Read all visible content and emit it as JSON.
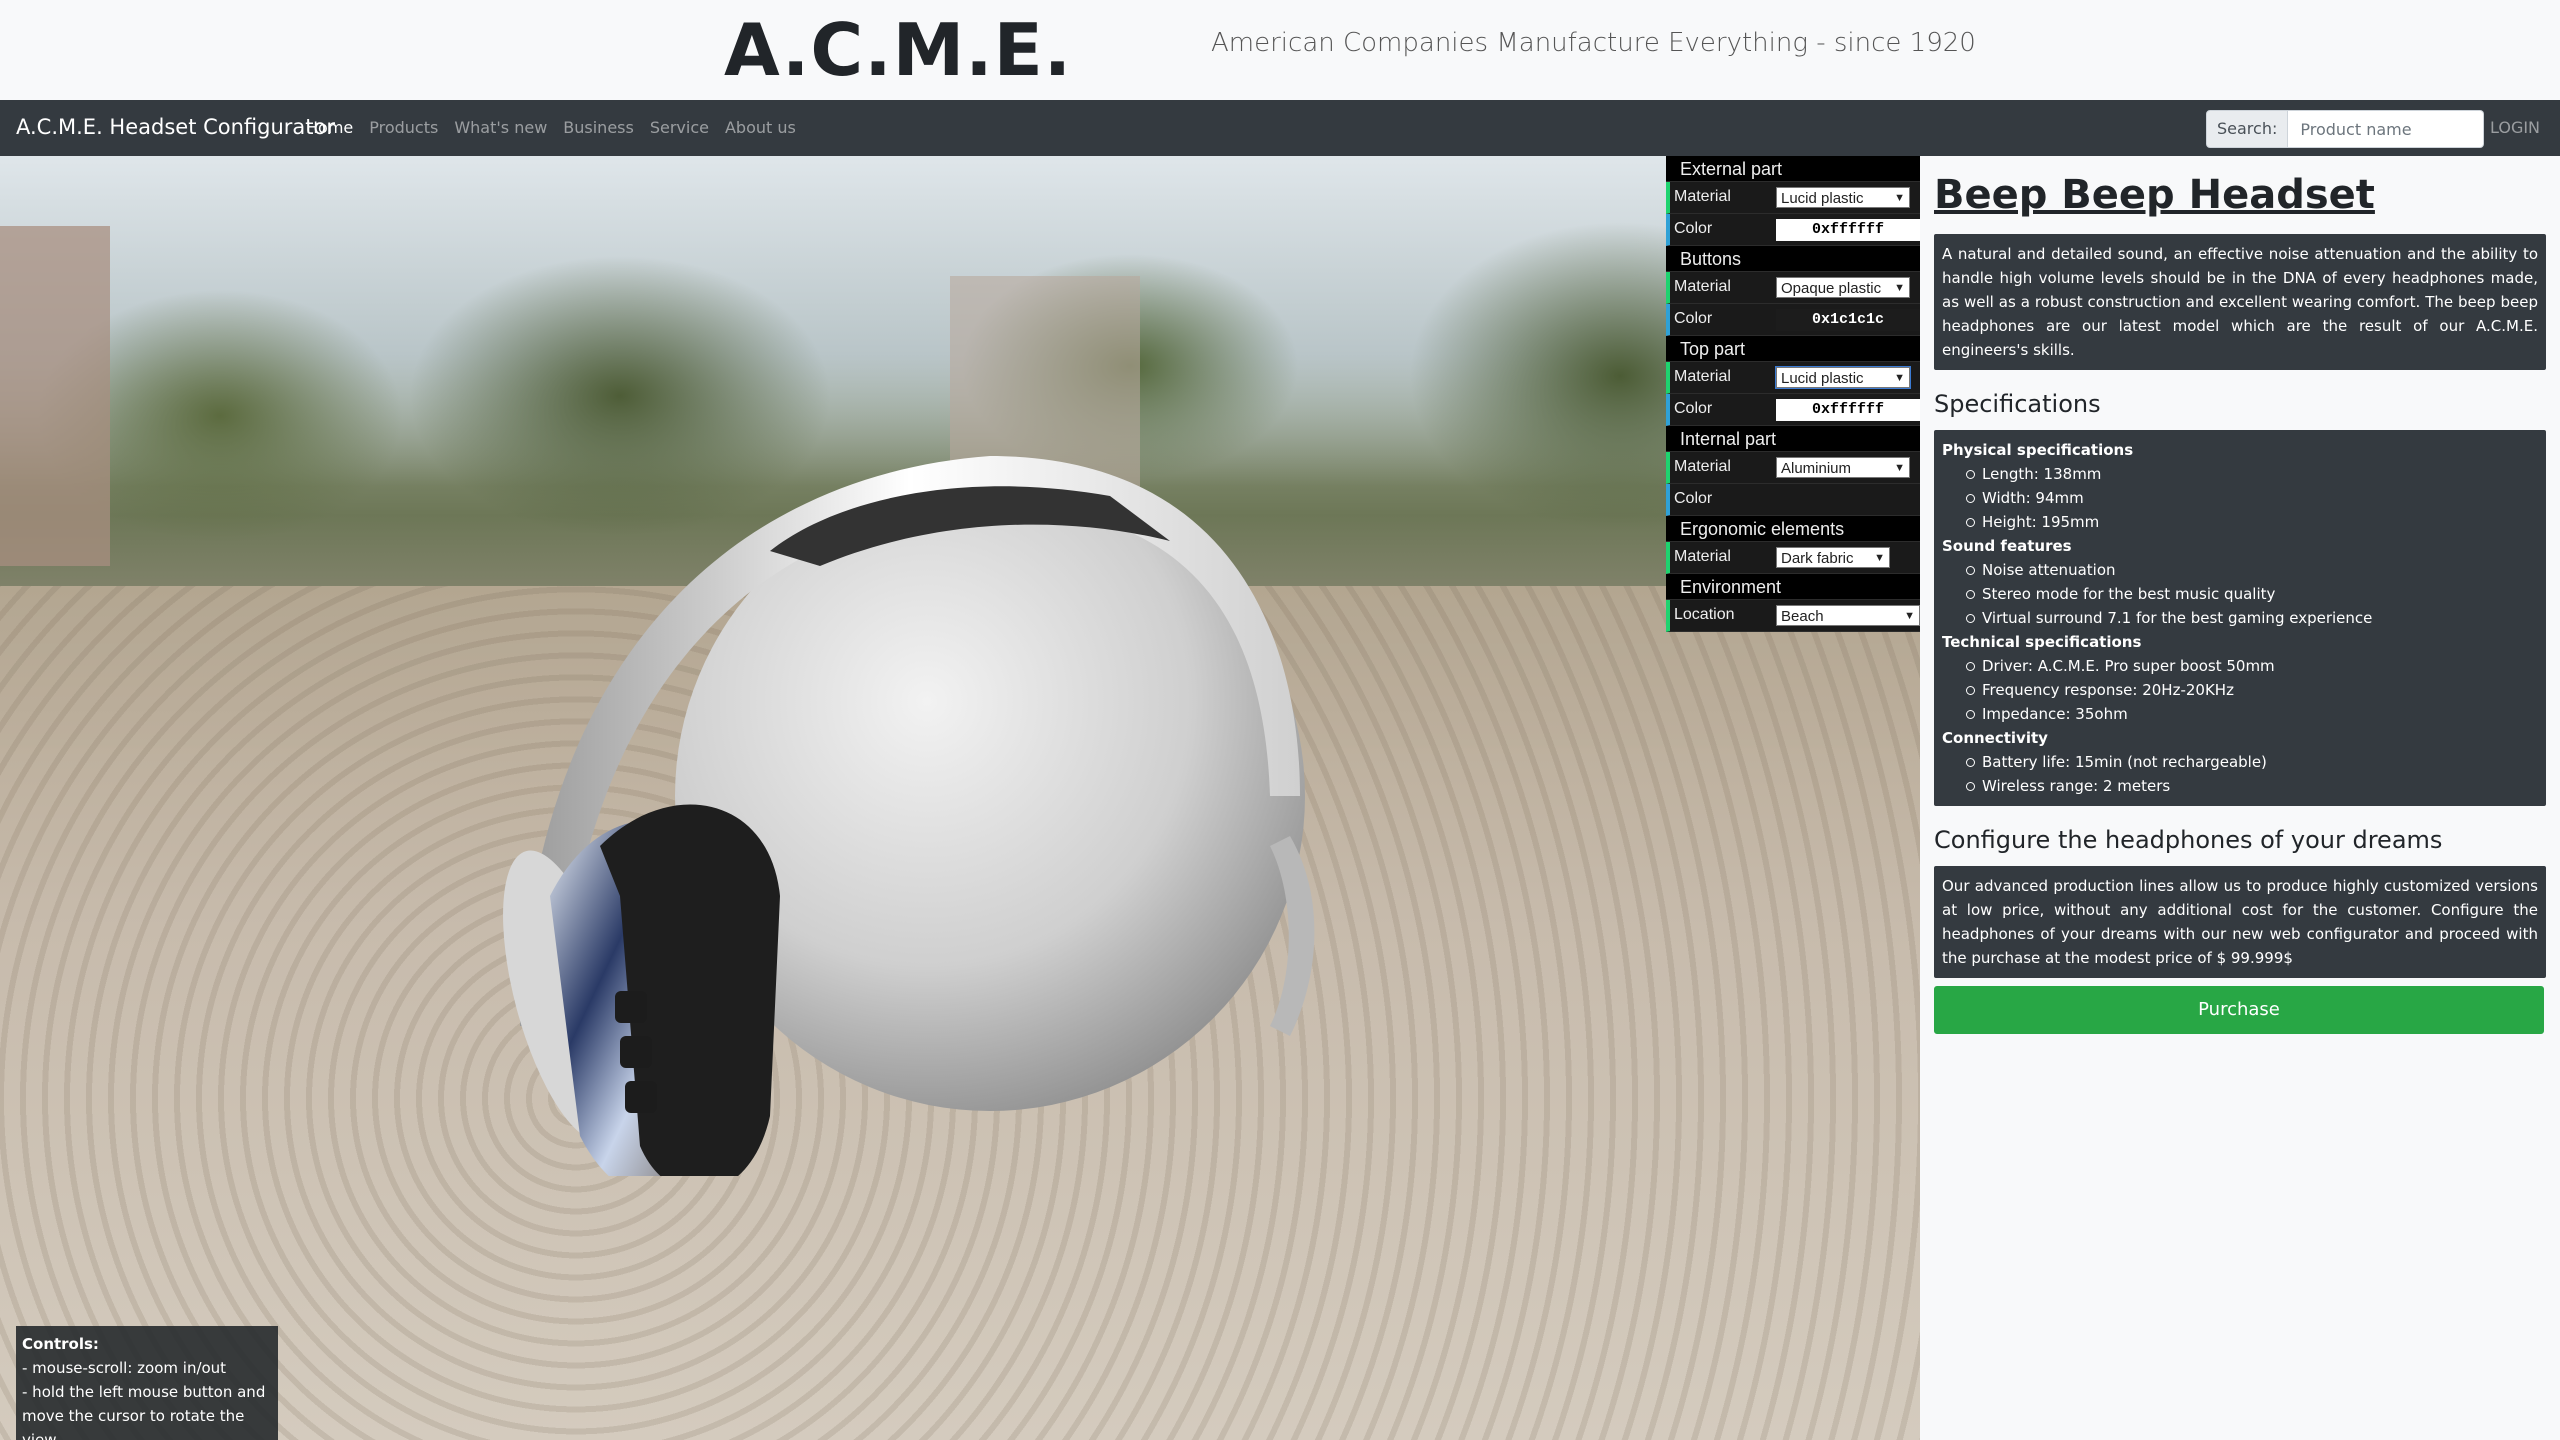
{
  "banner": {
    "logo": "A.C.M.E.",
    "tagline": "American Companies Manufacture Everything - since 1920"
  },
  "navbar": {
    "brand": "A.C.M.E. Headset Configurator",
    "links": [
      "Home",
      "Products",
      "What's new",
      "Business",
      "Service",
      "About us"
    ],
    "search_label": "Search:",
    "search_placeholder": "Product name",
    "login": "LOGIN"
  },
  "viewport": {
    "controls_title": "Controls:",
    "controls_lines": [
      "- mouse-scroll: zoom in/out",
      "- hold the left mouse button and",
      "move the cursor to rotate the view"
    ]
  },
  "gui": {
    "external": {
      "title": "External part",
      "material_label": "Material",
      "material": "Lucid plastic",
      "color_label": "Color",
      "color": "0xffffff",
      "color_hex": "#ffffff"
    },
    "buttons": {
      "title": "Buttons",
      "material_label": "Material",
      "material": "Opaque plastic",
      "color_label": "Color",
      "color": "0x1c1c1c",
      "color_hex": "#1c1c1c"
    },
    "top": {
      "title": "Top part",
      "material_label": "Material",
      "material": "Lucid plastic",
      "color_label": "Color",
      "color": "0xffffff",
      "color_hex": "#ffffff"
    },
    "internal": {
      "title": "Internal part",
      "material_label": "Material",
      "material": "Aluminium",
      "color_label": "Color"
    },
    "ergonomic": {
      "title": "Ergonomic elements",
      "material_label": "Material",
      "material": "Dark fabric"
    },
    "environment": {
      "title": "Environment",
      "location_label": "Location",
      "location": "Beach"
    }
  },
  "product": {
    "title": "Beep Beep Headset",
    "description": "A natural and detailed sound, an effective noise attenuation and the ability to handle high volume levels should be in the DNA of every headphones made, as well as a robust construction and excellent wearing comfort. The beep beep headphones are our latest model which are the result of our A.C.M.E. engineers's skills.",
    "specs_title": "Specifications",
    "specs": [
      {
        "group": "Physical specifications",
        "items": [
          "Length: 138mm",
          "Width: 94mm",
          "Height: 195mm"
        ]
      },
      {
        "group": "Sound features",
        "items": [
          "Noise attenuation",
          "Stereo mode for the best music quality",
          "Virtual surround 7.1 for the best gaming experience"
        ]
      },
      {
        "group": "Technical specifications",
        "items": [
          "Driver: A.C.M.E. Pro super boost 50mm",
          "Frequency response: 20Hz-20KHz",
          "Impedance: 35ohm"
        ]
      },
      {
        "group": "Connectivity",
        "items": [
          "Battery life: 15min (not rechargeable)",
          "Wireless range: 2 meters"
        ]
      }
    ],
    "configure_title": "Configure the headphones of your dreams",
    "configure_text": "Our advanced production lines allow us to produce highly customized versions at low price, without any additional cost for the customer. Configure the headphones of your dreams with our new web configurator and proceed with the purchase at the modest price of $ 99.999$",
    "purchase_label": "Purchase"
  }
}
